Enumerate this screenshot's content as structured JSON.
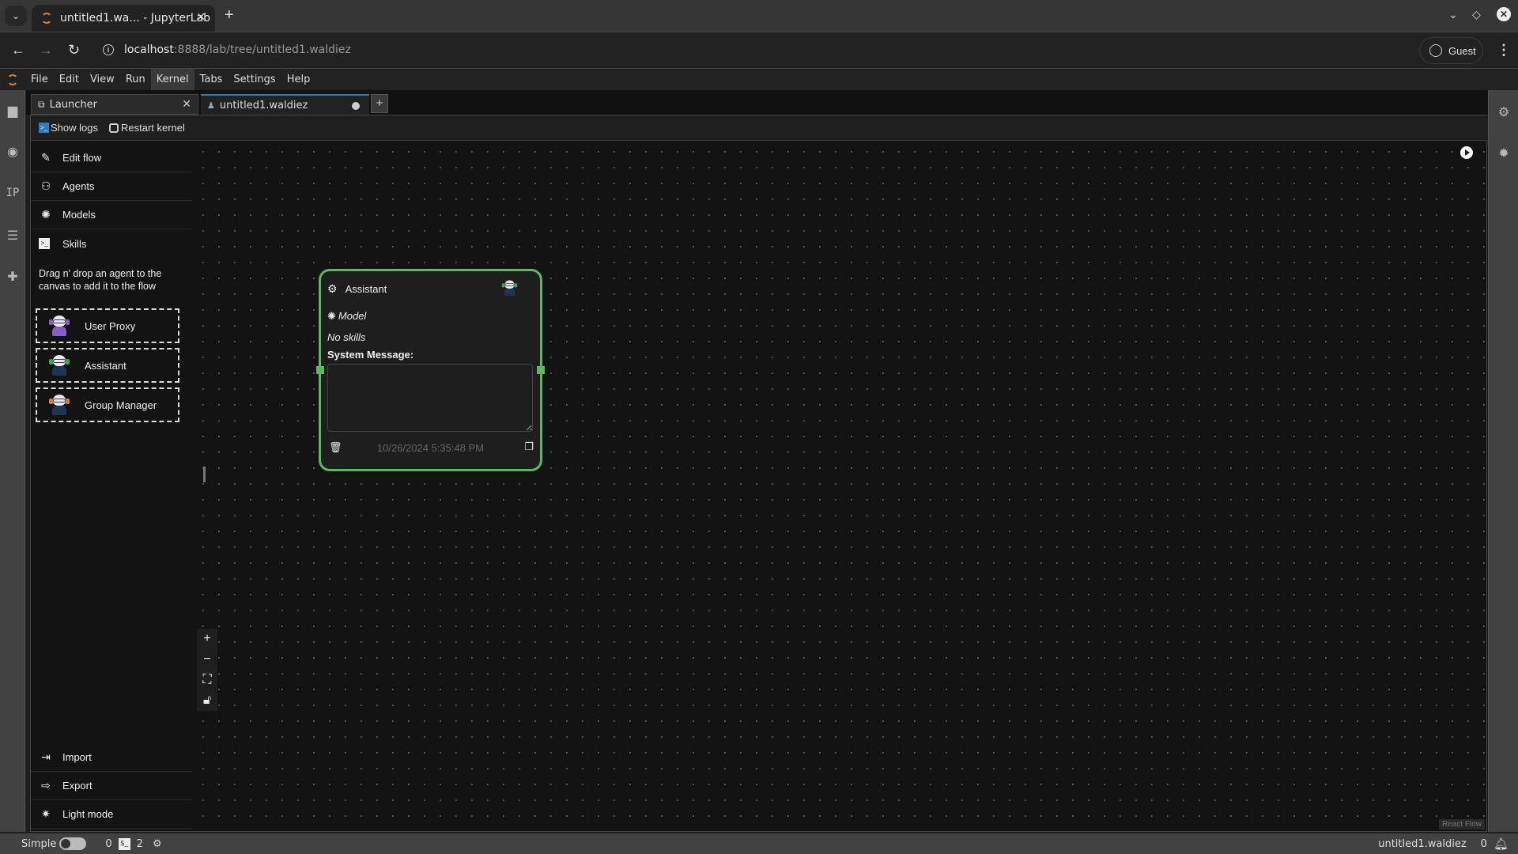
{
  "browser": {
    "tab_title": "untitled1.wa... - JupyterLab",
    "url_host": "localhost",
    "url_rest": ":8888/lab/tree/untitled1.waldiez",
    "profile_label": "Guest"
  },
  "menubar": {
    "items": [
      "File",
      "Edit",
      "View",
      "Run",
      "Kernel",
      "Tabs",
      "Settings",
      "Help"
    ],
    "active": "Kernel"
  },
  "left_activity": {
    "ip_label": "IP"
  },
  "dock_tabs": [
    {
      "label": "Launcher",
      "icon": "launcher-icon"
    },
    {
      "label": "untitled1.waldiez",
      "icon": "waldiez-icon",
      "modified": true
    }
  ],
  "toolbar": {
    "show_logs": "Show logs",
    "restart_kernel": "Restart kernel"
  },
  "sidebar": {
    "items": [
      {
        "label": "Edit flow",
        "icon": "edit-icon"
      },
      {
        "label": "Agents",
        "icon": "robot-icon"
      },
      {
        "label": "Models",
        "icon": "openai-icon"
      },
      {
        "label": "Skills",
        "icon": "terminal-icon"
      }
    ],
    "drag_hint": "Drag n' drop an agent to the canvas to add it to the flow",
    "agents": [
      {
        "label": "User Proxy",
        "accent": "#8a5cc9"
      },
      {
        "label": "Assistant",
        "accent": "#3aa845"
      },
      {
        "label": "Group Manager",
        "accent": "#d4843a"
      }
    ],
    "bottom_items": [
      {
        "label": "Import",
        "icon": "import-icon"
      },
      {
        "label": "Export",
        "icon": "export-icon"
      },
      {
        "label": "Light mode",
        "icon": "sun-icon"
      }
    ]
  },
  "node": {
    "title": "Assistant",
    "model": "Model",
    "skills": "No skills",
    "system_message_label": "System Message:",
    "system_message_value": "",
    "timestamp": "10/26/2024 5:35:48 PM",
    "border_color": "#5cb85c"
  },
  "canvas": {
    "attribution": "React Flow"
  },
  "statusbar": {
    "mode_label": "Simple",
    "count_a": "0",
    "count_terminals": "2",
    "filename": "untitled1.waldiez",
    "notifications": "0"
  }
}
